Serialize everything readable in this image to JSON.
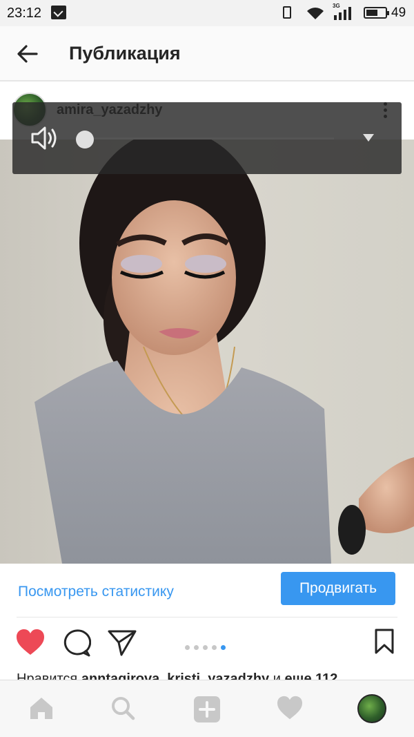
{
  "status_bar": {
    "time": "23:12",
    "network": "3G",
    "battery": "49"
  },
  "header": {
    "title": "Публикация"
  },
  "post": {
    "username": "amira_yazadzhy",
    "stats_link": "Посмотреть статистику",
    "promote_button": "Продвигать",
    "likes_prefix": "Нравится",
    "likes_users": "anntagirova, kristi_yazadzhy",
    "likes_and": "и",
    "likes_more": "еще 112",
    "carousel": {
      "total": 5,
      "current": 5
    }
  },
  "video_overlay": {
    "progress": 0
  },
  "icons": {
    "back": "arrow-left-icon",
    "more": "more-vertical-icon",
    "volume": "volume-icon",
    "dropdown": "dropdown-icon",
    "like": "heart-filled-icon",
    "comment": "comment-icon",
    "share": "send-icon",
    "save": "bookmark-icon",
    "nav_home": "home-icon",
    "nav_search": "search-icon",
    "nav_add": "add-icon",
    "nav_activity": "heart-icon"
  },
  "colors": {
    "accent": "#3897f0",
    "like": "#ed4956",
    "text": "#262626"
  }
}
